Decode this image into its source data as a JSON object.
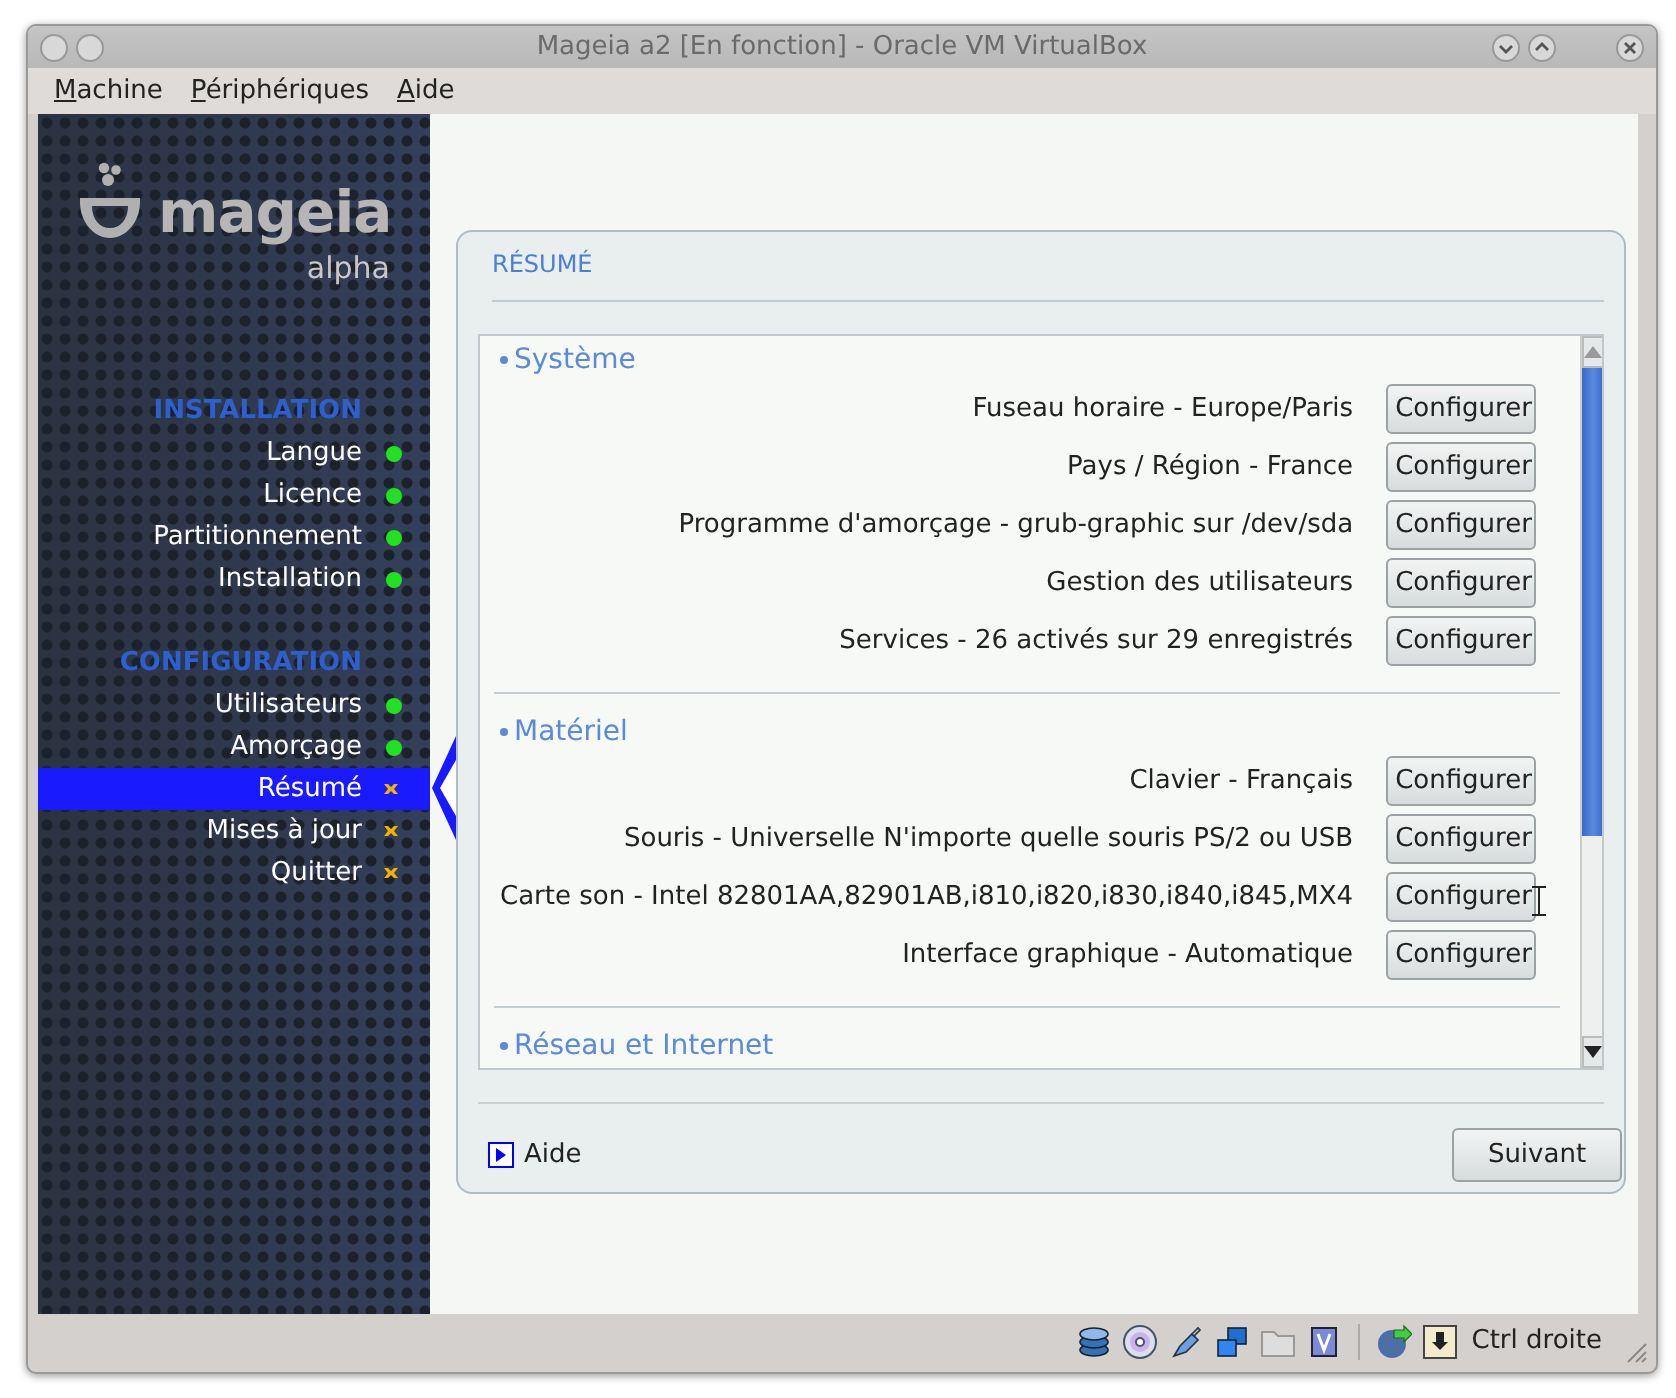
{
  "window": {
    "title": "Mageia a2 [En fonction] - Oracle VM VirtualBox"
  },
  "menu": [
    "Machine",
    "Périphériques",
    "Aide"
  ],
  "sidebar": {
    "logo": "mageia",
    "edition": "alpha",
    "sections": [
      {
        "title": "INSTALLATION",
        "items": [
          {
            "label": "Langue",
            "complete": true,
            "selected": false
          },
          {
            "label": "Licence",
            "complete": true,
            "selected": false
          },
          {
            "label": "Partitionnement",
            "complete": true,
            "selected": false
          },
          {
            "label": "Installation",
            "complete": true,
            "selected": false
          }
        ]
      },
      {
        "title": "CONFIGURATION",
        "items": [
          {
            "label": "Utilisateurs",
            "complete": true,
            "selected": false
          },
          {
            "label": "Amorçage",
            "complete": true,
            "selected": false
          },
          {
            "label": "Résumé",
            "complete": false,
            "selected": true
          },
          {
            "label": "Mises à jour",
            "complete": false,
            "selected": false
          },
          {
            "label": "Quitter",
            "complete": false,
            "selected": false
          }
        ]
      }
    ]
  },
  "summary": {
    "title": "RÉSUMÉ",
    "groups": [
      {
        "title": "Système",
        "rows": [
          {
            "label": "Fuseau horaire - Europe/Paris",
            "button": "Configurer"
          },
          {
            "label": "Pays / Région - France",
            "button": "Configurer"
          },
          {
            "label": "Programme d'amorçage - grub-graphic sur /dev/sda",
            "button": "Configurer"
          },
          {
            "label": "Gestion des utilisateurs",
            "button": "Configurer"
          },
          {
            "label": "Services - 26 activés sur 29 enregistrés",
            "button": "Configurer"
          }
        ]
      },
      {
        "title": "Matériel",
        "rows": [
          {
            "label": "Clavier - Français",
            "button": "Configurer"
          },
          {
            "label": "Souris - Universelle N'importe quelle souris PS/2 ou USB",
            "button": "Configurer"
          },
          {
            "label": "Carte son - Intel 82801AA,82901AB,i810,i820,i830,i840,i845,MX4",
            "button": "Configurer"
          },
          {
            "label": "Interface graphique - Automatique",
            "button": "Configurer"
          }
        ]
      },
      {
        "title": "Réseau et Internet"
      }
    ],
    "help": "Aide",
    "next": "Suivant"
  },
  "status_bar": {
    "host_key": "Ctrl droite"
  }
}
